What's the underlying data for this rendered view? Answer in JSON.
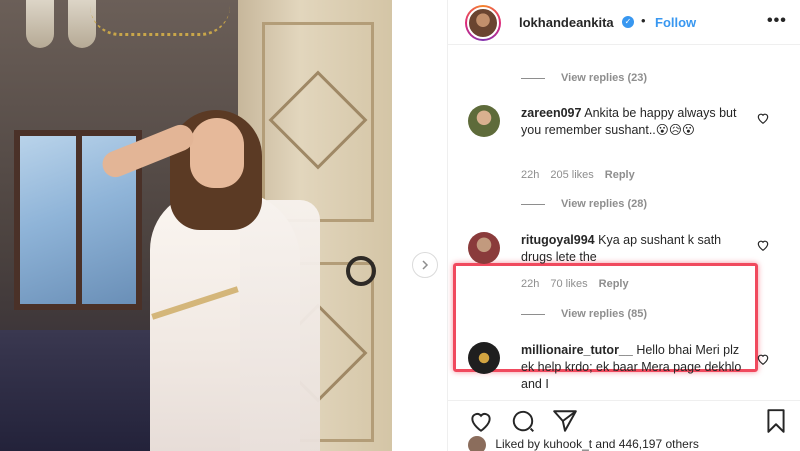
{
  "header": {
    "username": "lokhandeankita",
    "separator": "•",
    "follow_label": "Follow",
    "more_label": "•••"
  },
  "comments": {
    "replies_1": "View replies (23)",
    "c1": {
      "username": "zareen097",
      "text": "Ankita be happy always but you remember sushant..😮😥😮",
      "time": "22h",
      "likes": "205 likes",
      "reply": "Reply"
    },
    "replies_2": "View replies (28)",
    "c2": {
      "username": "ritugoyal994",
      "text": "Kya ap sushant k sath drugs lete the",
      "time": "22h",
      "likes": "70 likes",
      "reply": "Reply"
    },
    "replies_3": "View replies (85)",
    "c3": {
      "username": "millionaire_tutor__",
      "text": "Hello bhai Meri plz ek help krdo; ek baar Mera page dekhlo and I"
    }
  },
  "footer": {
    "liked_by": "Liked by kuhook_t and 446,197 others"
  },
  "colors": {
    "accent": "#3897f0",
    "highlight": "#f04a5e",
    "secondary_text": "#8e8e8e"
  },
  "icons": [
    "heart-icon",
    "comment-icon",
    "share-icon",
    "bookmark-icon",
    "verified-badge-icon",
    "chevron-right-icon"
  ]
}
